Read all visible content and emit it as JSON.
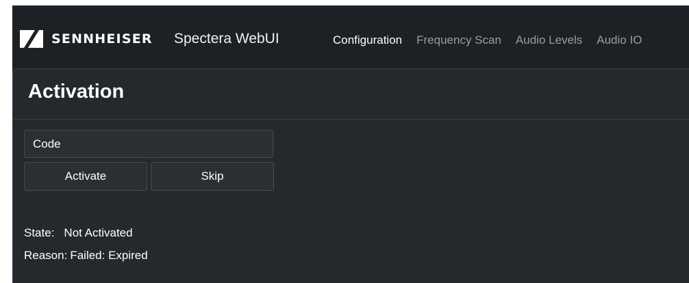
{
  "header": {
    "brand": "SENNHEISER",
    "logo_icon": "sennheiser-logo-icon",
    "app_title": "Spectera WebUI",
    "nav": [
      {
        "label": "Configuration",
        "active": true
      },
      {
        "label": "Frequency Scan",
        "active": false
      },
      {
        "label": "Audio Levels",
        "active": false
      },
      {
        "label": "Audio IO",
        "active": false
      }
    ]
  },
  "card": {
    "title": "Activation",
    "code_input": {
      "placeholder": "Code",
      "value": ""
    },
    "activate_label": "Activate",
    "skip_label": "Skip",
    "state_label": "State:",
    "state_value": "Not Activated",
    "reason_label": "Reason:",
    "reason_value": "Failed: Expired"
  },
  "colors": {
    "background": "#1f2226",
    "card": "#25282d",
    "nav_active": "#ffffff",
    "nav_inactive": "#9a9ea3"
  }
}
